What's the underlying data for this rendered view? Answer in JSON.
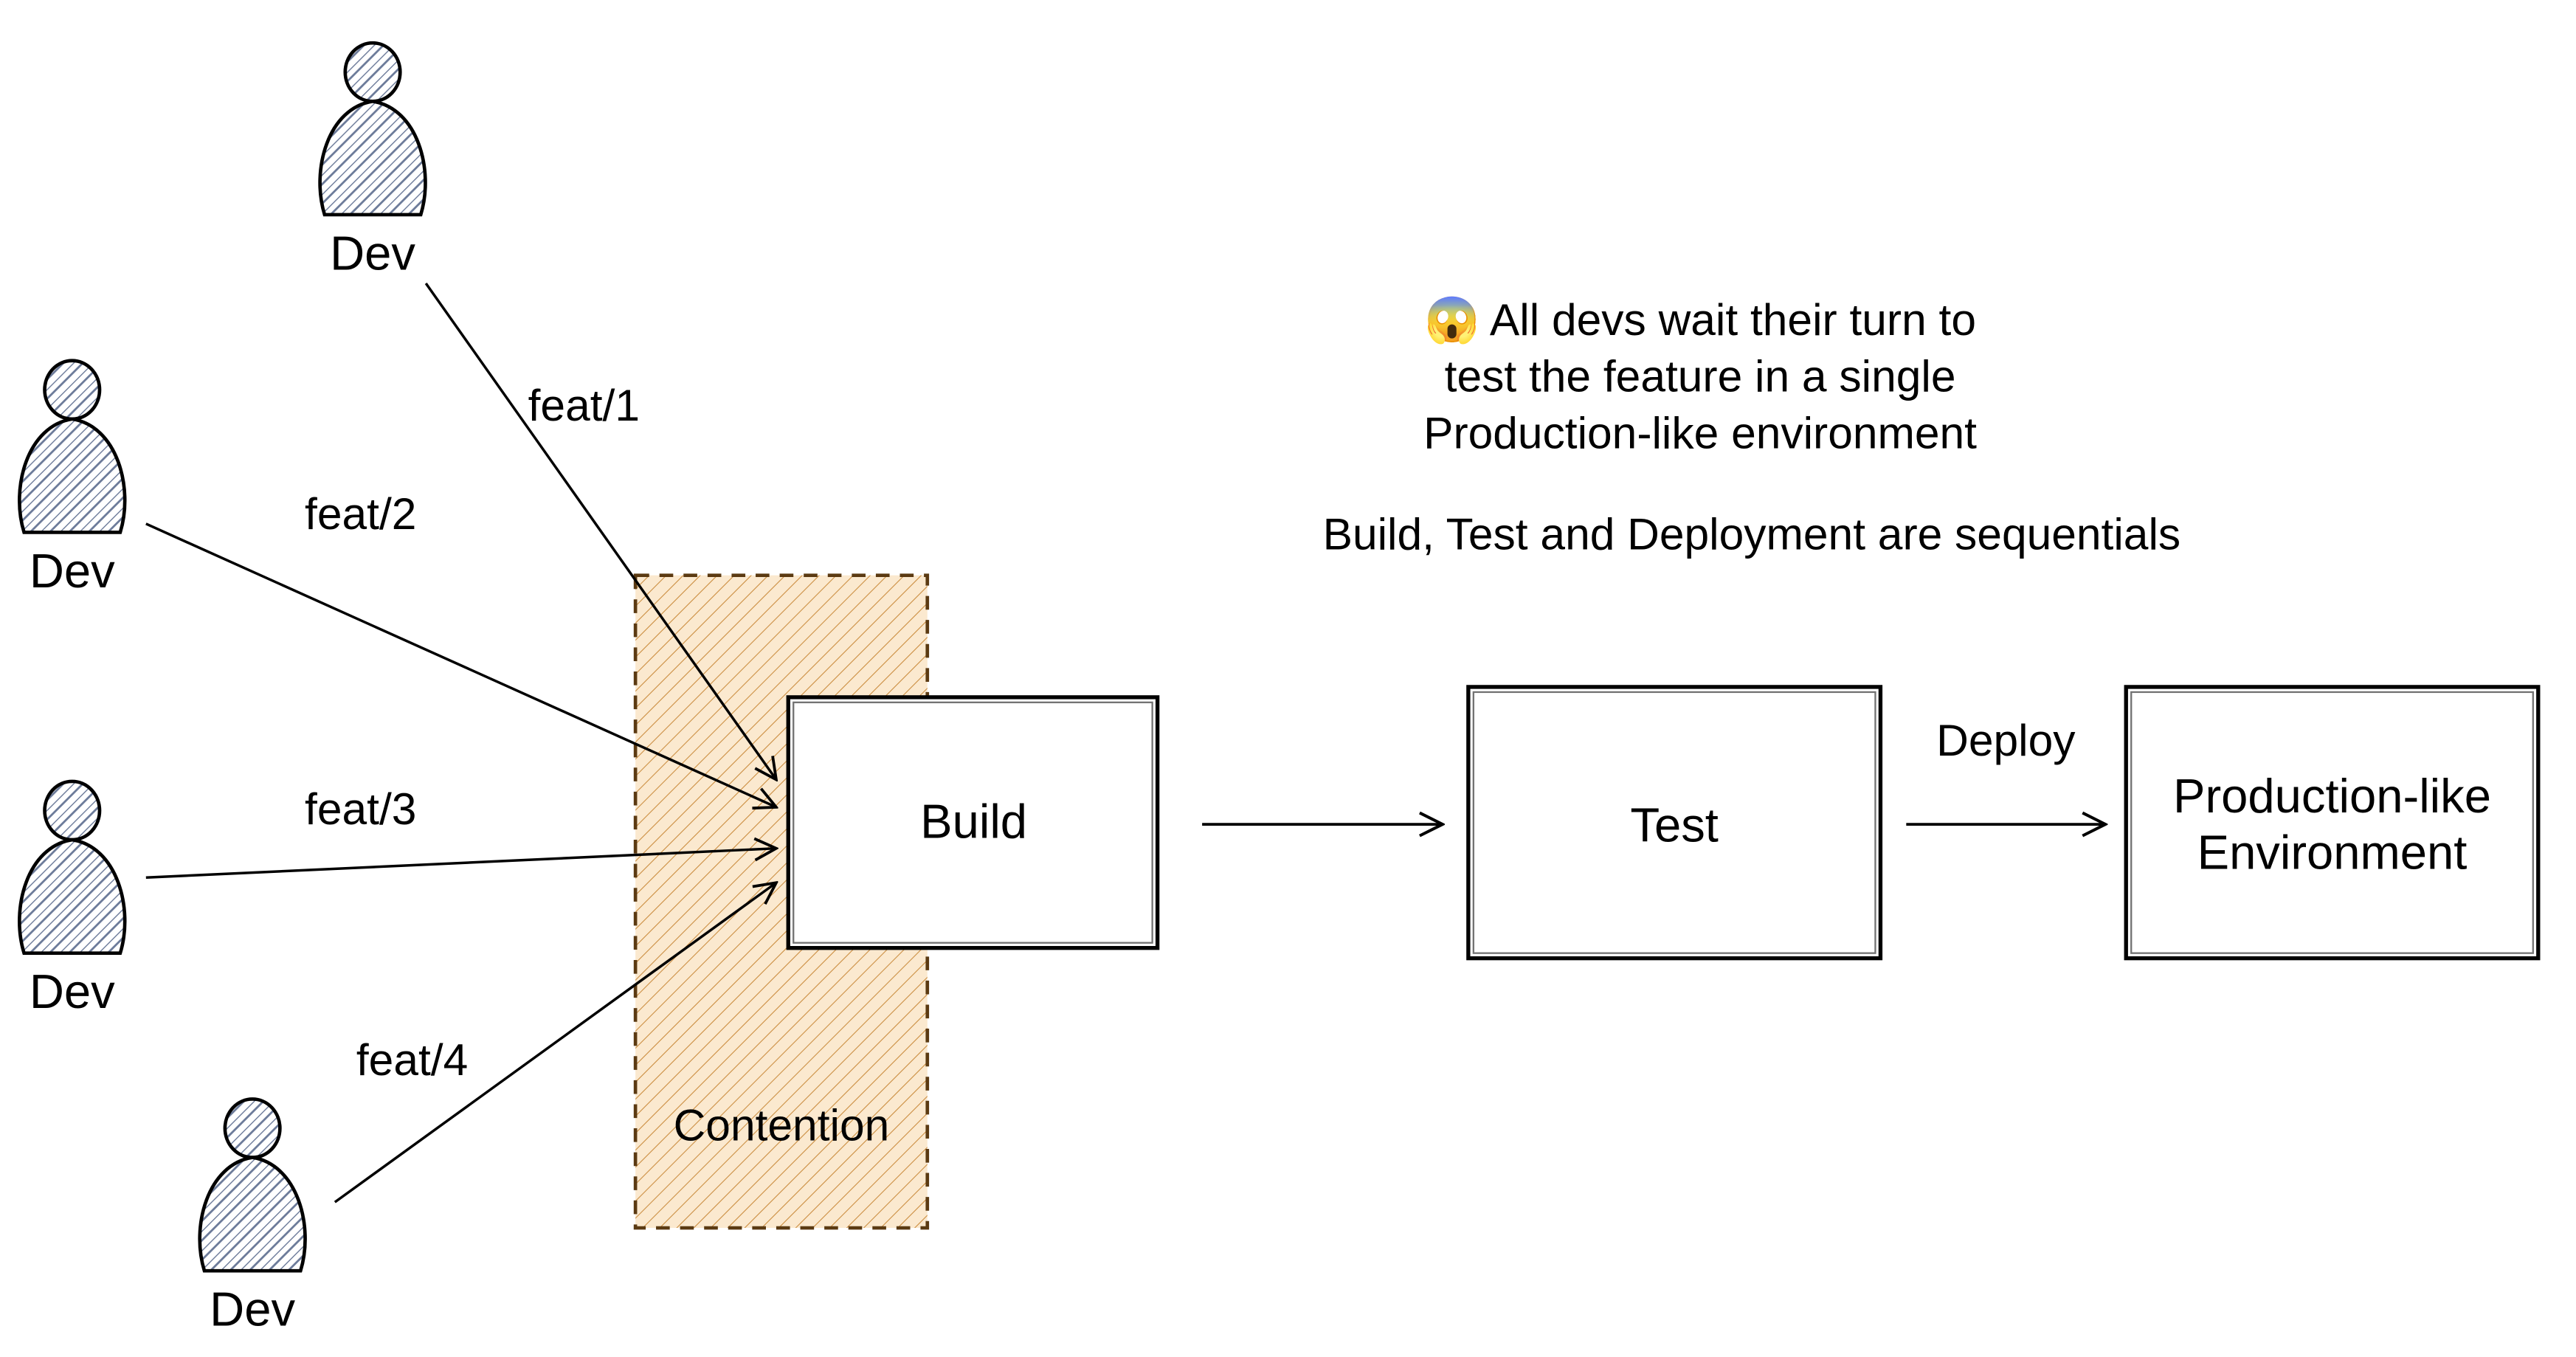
{
  "devs": [
    {
      "label": "Dev"
    },
    {
      "label": "Dev"
    },
    {
      "label": "Dev"
    },
    {
      "label": "Dev"
    }
  ],
  "branches": {
    "f1": "feat/1",
    "f2": "feat/2",
    "f3": "feat/3",
    "f4": "feat/4"
  },
  "contention_label": "Contention",
  "boxes": {
    "build": "Build",
    "test": "Test",
    "prod_line1": "Production-like",
    "prod_line2": "Environment"
  },
  "deploy_label": "Deploy",
  "annotation": {
    "emoji": "😱",
    "line1a": " All devs wait their turn to",
    "line2": "test the feature in a single",
    "line3": "Production-like environment",
    "line4": "Build, Test and Deployment are sequentials"
  }
}
